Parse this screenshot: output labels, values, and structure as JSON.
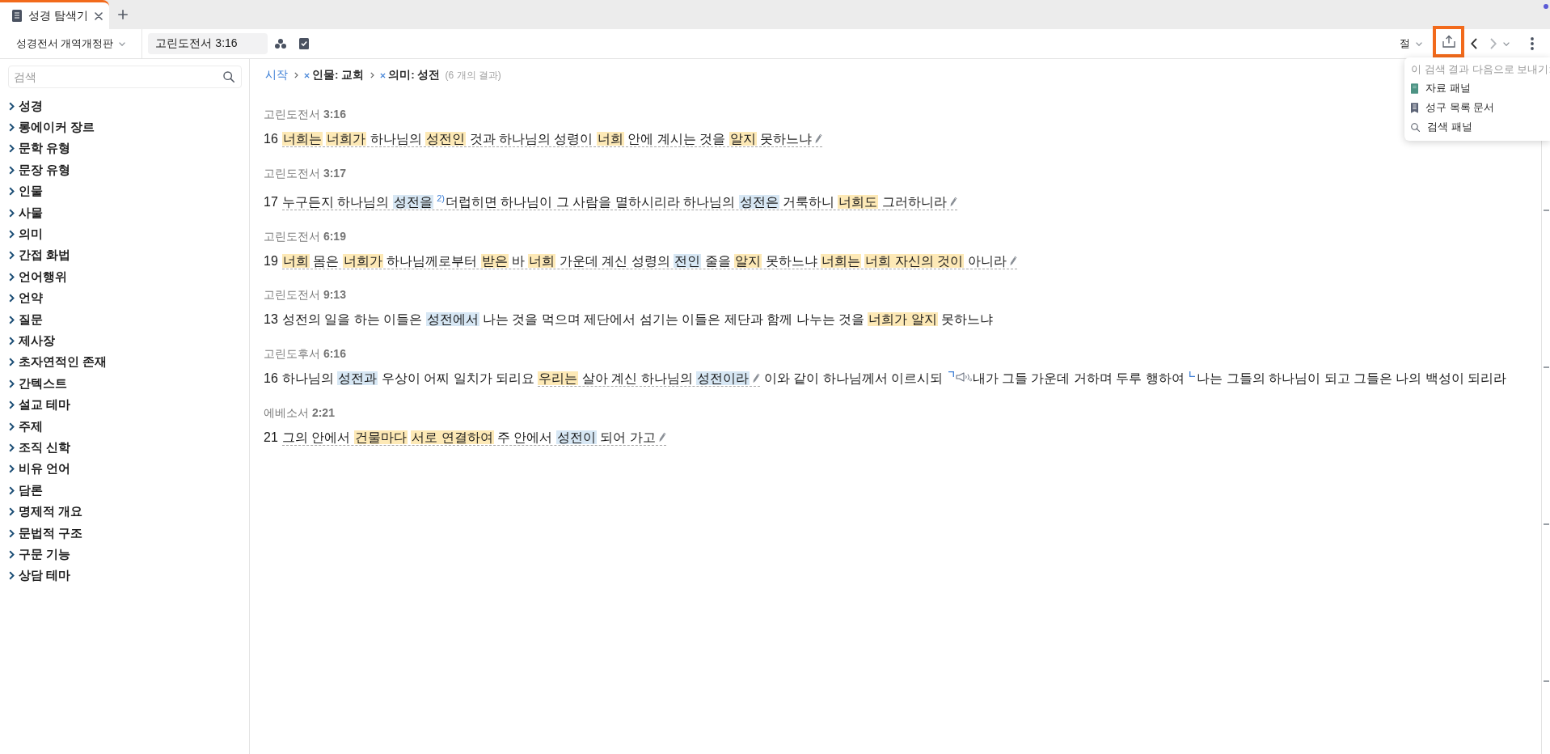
{
  "tab_bar": {
    "tabs": [
      {
        "label": "성경 탐색기",
        "selected": true
      }
    ]
  },
  "toolbar": {
    "version": "성경전서 개역개정판",
    "reference": "고린도전서 3:16",
    "unit": "절",
    "share_highlighted": true,
    "back_disabled": false,
    "forward_disabled": true
  },
  "send_menu": {
    "heading": "이 검색 결과 다음으로 보내기:",
    "items": [
      {
        "kind": "resource",
        "label": "자료 패널"
      },
      {
        "kind": "list",
        "label": "성구 목록 문서"
      },
      {
        "kind": "search",
        "label": "검색 패널"
      }
    ]
  },
  "sidebar": {
    "search": {
      "placeholder": "검색"
    },
    "items": [
      {
        "label": "성경",
        "expanded": false
      },
      {
        "label": "롱에이커 장르",
        "expanded": false
      },
      {
        "label": "문학 유형",
        "expanded": false
      },
      {
        "label": "문장 유형",
        "expanded": false
      },
      {
        "label": "인물",
        "expanded": false
      },
      {
        "label": "사물",
        "expanded": false
      },
      {
        "label": "의미",
        "expanded": false
      },
      {
        "label": "간접 화법",
        "expanded": false
      },
      {
        "label": "언어행위",
        "expanded": false
      },
      {
        "label": "언약",
        "expanded": false
      },
      {
        "label": "질문",
        "expanded": false
      },
      {
        "label": "제사장",
        "expanded": false
      },
      {
        "label": "초자연적인 존재",
        "expanded": false
      },
      {
        "label": "간텍스트",
        "expanded": false
      },
      {
        "label": "설교 테마",
        "expanded": false
      },
      {
        "label": "주제",
        "expanded": false
      },
      {
        "label": "조직 신학",
        "expanded": false
      },
      {
        "label": "비유 언어",
        "expanded": false
      },
      {
        "label": "담론",
        "expanded": false
      },
      {
        "label": "명제적 개요",
        "expanded": false
      },
      {
        "label": "문법적 구조",
        "expanded": false
      },
      {
        "label": "구문 기능",
        "expanded": false
      },
      {
        "label": "상담 테마",
        "expanded": false
      }
    ]
  },
  "breadcrumb": {
    "start": "시작",
    "filters": [
      "인물: 교회",
      "의미: 성전"
    ],
    "count": "(6 개의 결과)"
  },
  "results": [
    {
      "reference": "고린도전서 **3:16**",
      "verse_number": "16",
      "parts": [
        {
          "annotated": true,
          "items": [
            {
              "kind": "match",
              "text": "너희는 ",
              "color": "#fde9b6"
            },
            {
              "kind": "match",
              "text": "너희가",
              "color": "#fde9b6"
            },
            {
              "kind": "text",
              "text": " 하나님의 "
            },
            {
              "kind": "match",
              "text": "성전인",
              "color": "#fde9b6"
            },
            {
              "kind": "text",
              "text": " 것과 하나님의 성령이 "
            },
            {
              "kind": "match",
              "text": "너희",
              "color": "#fde9b6"
            },
            {
              "kind": "text",
              "text": " 안에 계시는 것을 "
            },
            {
              "kind": "match",
              "text": "알지",
              "color": "#fde9b6"
            },
            {
              "kind": "text",
              "text": " 못하느냐"
            },
            {
              "kind": "note"
            }
          ]
        }
      ]
    },
    {
      "reference": "고린도전서 **3:17**",
      "verse_number": "17",
      "parts": [
        {
          "annotated": true,
          "items": [
            {
              "kind": "text",
              "text": "누구든지 하나님의 "
            },
            {
              "kind": "match",
              "text": "성전을 ",
              "color": "#d7e7f4"
            },
            {
              "kind": "footnote",
              "text": "2)"
            },
            {
              "kind": "text",
              "text": "더럽히면 하나님이 그 사람을 멸하시리라 하나님의 "
            },
            {
              "kind": "match",
              "text": "성전은",
              "color": "#d7e7f4"
            },
            {
              "kind": "text",
              "text": " 거룩하니 "
            },
            {
              "kind": "match",
              "text": "너희도",
              "color": "#fde9b6"
            },
            {
              "kind": "text",
              "text": " 그러하니라"
            },
            {
              "kind": "note"
            }
          ]
        }
      ]
    },
    {
      "reference": "고린도전서 **6:19**",
      "verse_number": "19",
      "parts": [
        {
          "annotated": true,
          "items": [
            {
              "kind": "match",
              "text": "너희",
              "color": "#fde9b6"
            },
            {
              "kind": "text",
              "text": " 몸은 "
            },
            {
              "kind": "match",
              "text": "너희가",
              "color": "#fde9b6"
            },
            {
              "kind": "text",
              "text": " 하나님께로부터 "
            },
            {
              "kind": "match",
              "text": "받은",
              "color": "#fde9b6"
            },
            {
              "kind": "text",
              "text": " 바 "
            },
            {
              "kind": "match",
              "text": "너희",
              "color": "#fde9b6"
            },
            {
              "kind": "text",
              "text": " 가운데 계신 성령의 "
            },
            {
              "kind": "match",
              "text": "전인",
              "color": "#d7e7f4"
            },
            {
              "kind": "text",
              "text": " 줄을 "
            },
            {
              "kind": "match",
              "text": "알지",
              "color": "#fde9b6"
            },
            {
              "kind": "text",
              "text": " 못하느냐 "
            },
            {
              "kind": "match",
              "text": "너희는 ",
              "color": "#fde9b6"
            },
            {
              "kind": "match",
              "text": "너희 자신의 것이",
              "color": "#fde9b6"
            },
            {
              "kind": "text",
              "text": " 아니라"
            },
            {
              "kind": "note"
            }
          ]
        }
      ]
    },
    {
      "reference": "고린도전서 **9:13**",
      "verse_number": "13",
      "parts": [
        {
          "annotated": false,
          "items": [
            {
              "kind": "text",
              "text": "성전의 일을 하는 이들은 "
            },
            {
              "kind": "match",
              "text": "성전에서",
              "color": "#d7e7f4"
            },
            {
              "kind": "text",
              "text": " 나는 것을 먹으며 제단에서 섬기는 이들은 제단과 함께 나누는 것을 "
            },
            {
              "kind": "match",
              "text": "너희가 알지",
              "color": "#fde9b6"
            },
            {
              "kind": "text",
              "text": " 못하느냐"
            }
          ]
        }
      ]
    },
    {
      "reference": "고린도후서 **6:16**",
      "verse_number": "16",
      "parts": [
        {
          "annotated": false,
          "items": [
            {
              "kind": "text",
              "text": "하나님의 "
            },
            {
              "kind": "match",
              "text": "성전과",
              "color": "#d7e7f4"
            },
            {
              "kind": "text",
              "text": " 우상이 어찌 일치가 되리요 "
            }
          ]
        },
        {
          "annotated": true,
          "items": [
            {
              "kind": "match",
              "text": "우리는",
              "color": "#fde9b6"
            },
            {
              "kind": "text",
              "text": " 살아 계신 하나님의 "
            },
            {
              "kind": "match",
              "text": "성전이라",
              "color": "#d7e7f4"
            },
            {
              "kind": "note"
            }
          ]
        },
        {
          "annotated": false,
          "items": [
            {
              "kind": "text",
              "text": " 이와 같이 하나님께서 이르시되 "
            },
            {
              "kind": "bracket_open"
            },
            {
              "kind": "speaker"
            },
            {
              "kind": "text",
              "text": "내가 그들 가운데 거하며 두루 행하여 "
            },
            {
              "kind": "bracket_close"
            },
            {
              "kind": "text",
              "text": "나는 그들의 하나님이 되고 그들은 나의 백성이 되리라"
            }
          ]
        }
      ]
    },
    {
      "reference": "에베소서 **2:21**",
      "verse_number": "21",
      "parts": [
        {
          "annotated": true,
          "items": [
            {
              "kind": "text",
              "text": "그의 안에서 "
            },
            {
              "kind": "match",
              "text": "건물마다 ",
              "color": "#fde9b6"
            },
            {
              "kind": "match",
              "text": "서로 연결하여",
              "color": "#fde9b6"
            },
            {
              "kind": "text",
              "text": " 주 안에서 "
            },
            {
              "kind": "match",
              "text": "성전이",
              "color": "#d7e7f4"
            },
            {
              "kind": "text",
              "text": " 되어 가고"
            },
            {
              "kind": "note"
            }
          ]
        }
      ]
    }
  ]
}
